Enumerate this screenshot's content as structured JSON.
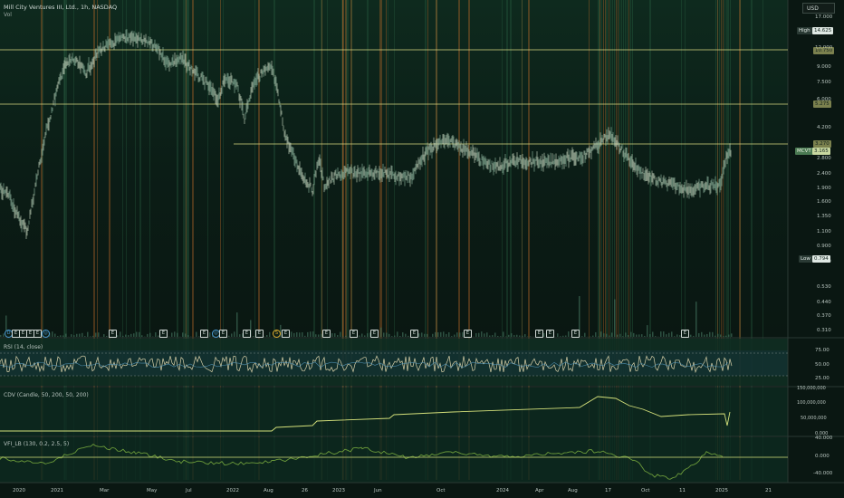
{
  "header": {
    "symbol_title": "Mill City Ventures III, Ltd., 1h, NASDAQ",
    "vol_label": "Vol",
    "currency_button": "USD"
  },
  "price_axis": {
    "ticks": [
      "17.000",
      "12.000",
      "9.000",
      "7.500",
      "6.000",
      "4.200",
      "2.800",
      "2.400",
      "1.900",
      "1.600",
      "1.350",
      "1.100",
      "0.900",
      "0.790",
      "0.530",
      "0.440",
      "0.370",
      "0.310"
    ],
    "high_label": "High",
    "high_value": "14.625",
    "low_label": "Low",
    "low_value": "0.794",
    "symbol_tag": "MCVT",
    "last_price": "3.165",
    "level_tags": [
      "10.750",
      "5.275",
      "3.270"
    ]
  },
  "rsi_panel": {
    "title": "RSI (14, close)",
    "ticks": [
      "75.00",
      "50.00",
      "25.00"
    ]
  },
  "cdv_panel": {
    "title": "CDV (Candle, 50, 200, 50, 200)",
    "ticks": [
      "150,000,000",
      "100,000,000",
      "50,000,000",
      "0.000"
    ]
  },
  "vfi_panel": {
    "title": "VFI_LB (130, 0.2, 2.5, 5)",
    "ticks": [
      "40.000",
      "0.000",
      "-40.000"
    ]
  },
  "time_axis": {
    "labels": [
      "2020",
      "2021",
      "Mar",
      "May",
      "Jul",
      "2022",
      "Aug",
      "26",
      "2023",
      "Jun",
      "Oct",
      "2024",
      "Apr",
      "Aug",
      "17",
      "Oct",
      "11",
      "2025",
      "21"
    ]
  },
  "events": {
    "labels": [
      "D",
      "E",
      "E",
      "E",
      "E",
      "S",
      "E",
      "E",
      "E",
      "E",
      "E",
      "E",
      "E",
      "E",
      "E",
      "E",
      "E",
      "E",
      "E"
    ]
  },
  "colors": {
    "background": "#0a1712",
    "price_line": "#c8d8a0",
    "level_line": "#d8d880",
    "rsi_line": "#d8d0a8",
    "cdv_line": "#d4e07a",
    "vfi_line": "#6b9a3a",
    "orange_band": "#c8702a",
    "green_band": "#2d6b48"
  }
}
